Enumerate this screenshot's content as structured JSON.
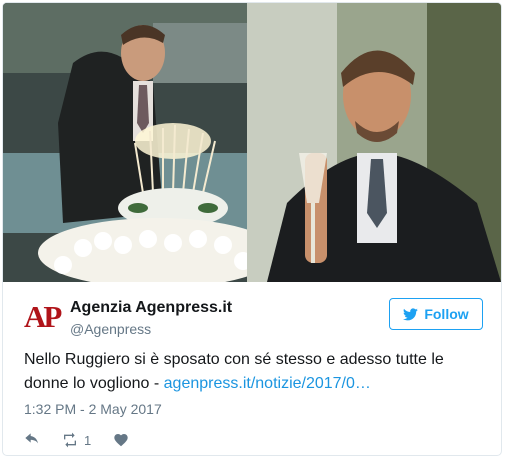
{
  "account": {
    "logo_text": "AP",
    "display_name": "Agenzia Agenpress.it",
    "handle": "@Agenpress"
  },
  "follow_button": {
    "label": "Follow",
    "icon": "twitter-bird-icon"
  },
  "tweet": {
    "text": "Nello Ruggiero si è sposato con sé stesso e adesso tutte le donne lo vogliono - ",
    "link_text": "agenpress.it/notizie/2017/0…",
    "timestamp": "1:32 PM - 2 May 2017"
  },
  "actions": {
    "reply_icon": "reply-icon",
    "retweet_icon": "retweet-icon",
    "retweet_count": "1",
    "like_icon": "heart-icon"
  },
  "colors": {
    "accent": "#1da1f2",
    "link": "#1b95e0",
    "logo_red": "#b0141a",
    "muted": "#657786"
  }
}
